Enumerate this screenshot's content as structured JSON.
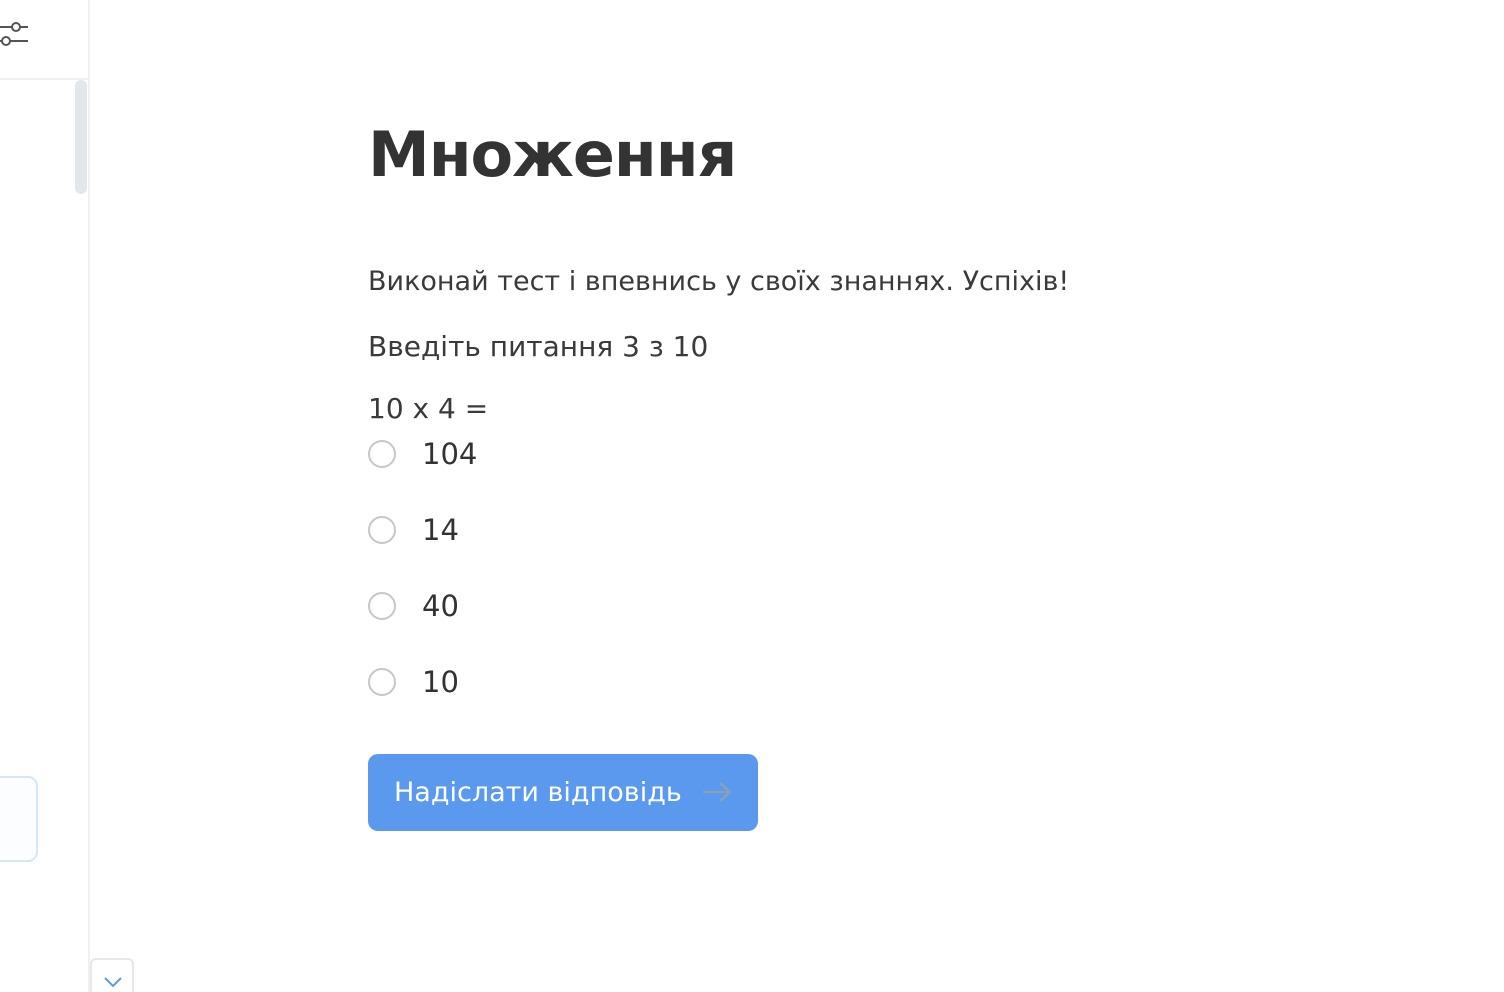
{
  "quiz": {
    "title": "Множення",
    "description": "Виконай тест і впевнись у своїх знаннях. Успіхів!",
    "progress_text": "Введіть питання 3 з 10",
    "question": "10 x 4 =",
    "options": [
      "104",
      "14",
      "40",
      "10"
    ],
    "submit_label": "Надіслати відповідь"
  },
  "icons": {
    "filter": "filter-sliders-icon",
    "submit_arrow": "arrow-right-icon",
    "collapse": "chevron-down-icon"
  },
  "colors": {
    "accent": "#5a99ee",
    "text": "#333333",
    "border": "#eef0f3"
  }
}
